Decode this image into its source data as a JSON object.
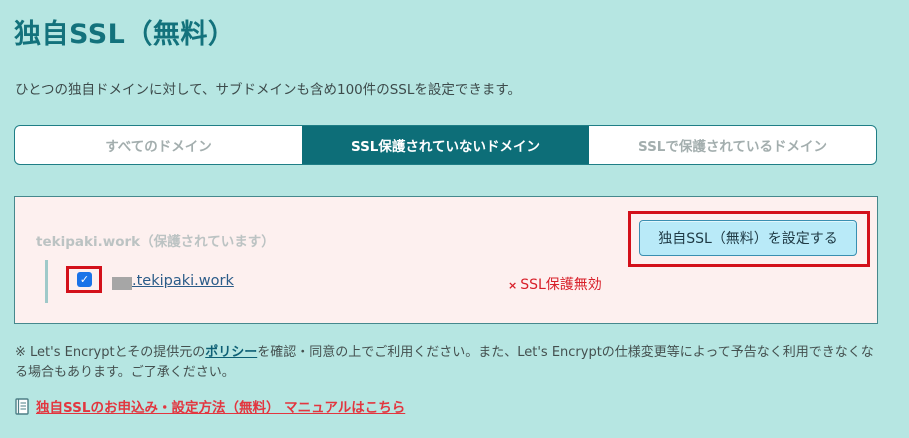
{
  "header": {
    "title": "独自SSL（無料）",
    "description": "ひとつの独自ドメインに対して、サブドメインも含め100件のSSLを設定できます。"
  },
  "tabs": [
    {
      "label": "すべてのドメイン",
      "active": false
    },
    {
      "label": "SSL保護されていないドメイン",
      "active": true
    },
    {
      "label": "SSLで保護されているドメイン",
      "active": false
    }
  ],
  "panel": {
    "group_label": "tekipaki.work（保護されています）",
    "set_button_label": "独自SSL（無料）を設定する",
    "domain": {
      "name": ".tekipaki.work",
      "checked": true,
      "status_icon": "×",
      "status": "SSL保護無効"
    }
  },
  "note": {
    "prefix": "※ Let's Encryptとその提供元の",
    "policy_link": "ポリシー",
    "suffix": "を確認・同意の上でご利用ください。また、Let's Encryptの仕様変更等によって予告なく利用できなくなる場合もあります。ご了承ください。"
  },
  "manual": {
    "icon": "book-icon",
    "link": "独自SSLのお申込み・設定方法（無料） マニュアルはこちら"
  },
  "colors": {
    "background": "#b6e6e2",
    "title": "#13727c",
    "active_tab": "#0d6e78",
    "panel_bg": "#fdf0ef",
    "status_red": "#d8202a",
    "highlight_red": "#d3101a",
    "button_bg": "#b9eaf8",
    "manual_link": "#e2363f"
  }
}
